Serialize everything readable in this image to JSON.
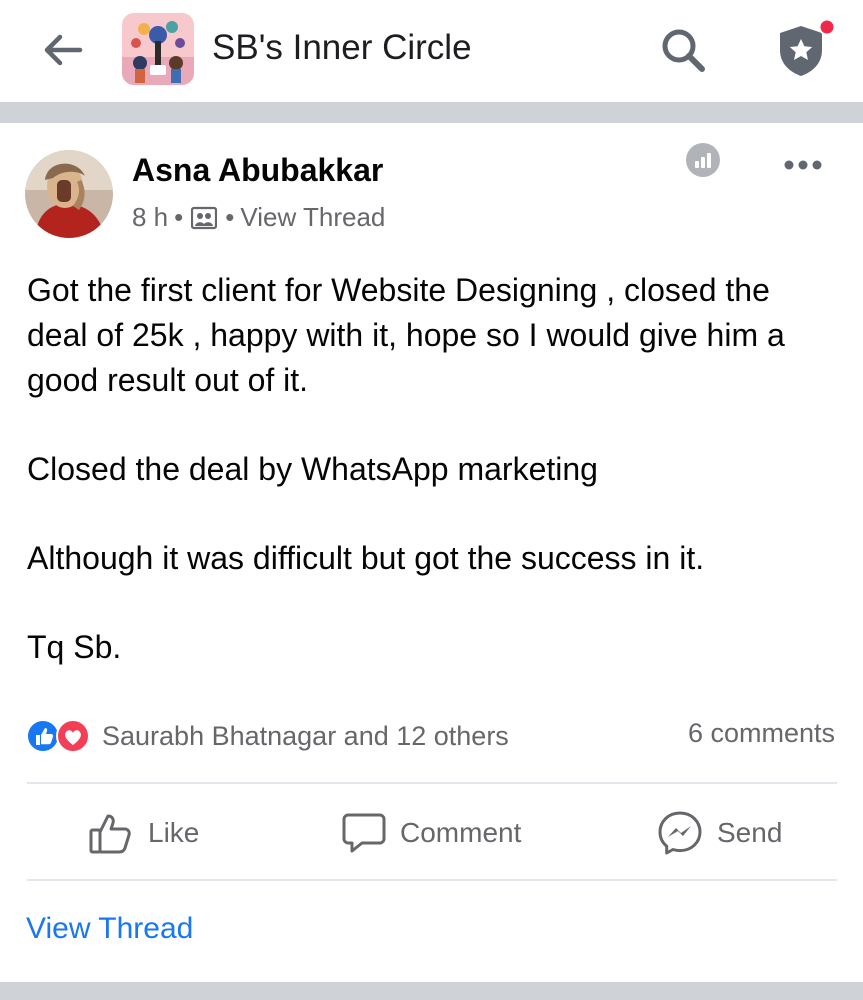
{
  "header": {
    "title": "SB's Inner Circle",
    "back_icon": "arrow-left-icon",
    "search_icon": "search-icon",
    "shield_icon": "admin-shield-star-icon",
    "notification_dot_color": "#f02849"
  },
  "post": {
    "author": "Asna Abubakkar",
    "time": "8 h",
    "separator": "•",
    "view_thread_meta": "View Thread",
    "paragraphs": [
      "Got the first client for Website Designing , closed the deal of 25k , happy with it, hope so I would give him a good result out of it.",
      "Closed the deal by WhatsApp marketing",
      "Although it was difficult but got the success in it.",
      "Tq Sb."
    ]
  },
  "reactions": {
    "summary": "Saurabh Bhatnagar and 12 others",
    "comments": "6 comments",
    "like_color": "#1877f2",
    "love_color": "#f33e58"
  },
  "actions": {
    "like": "Like",
    "comment": "Comment",
    "send": "Send"
  },
  "footer": {
    "view_thread": "View Thread",
    "link_color": "#1877f2"
  }
}
